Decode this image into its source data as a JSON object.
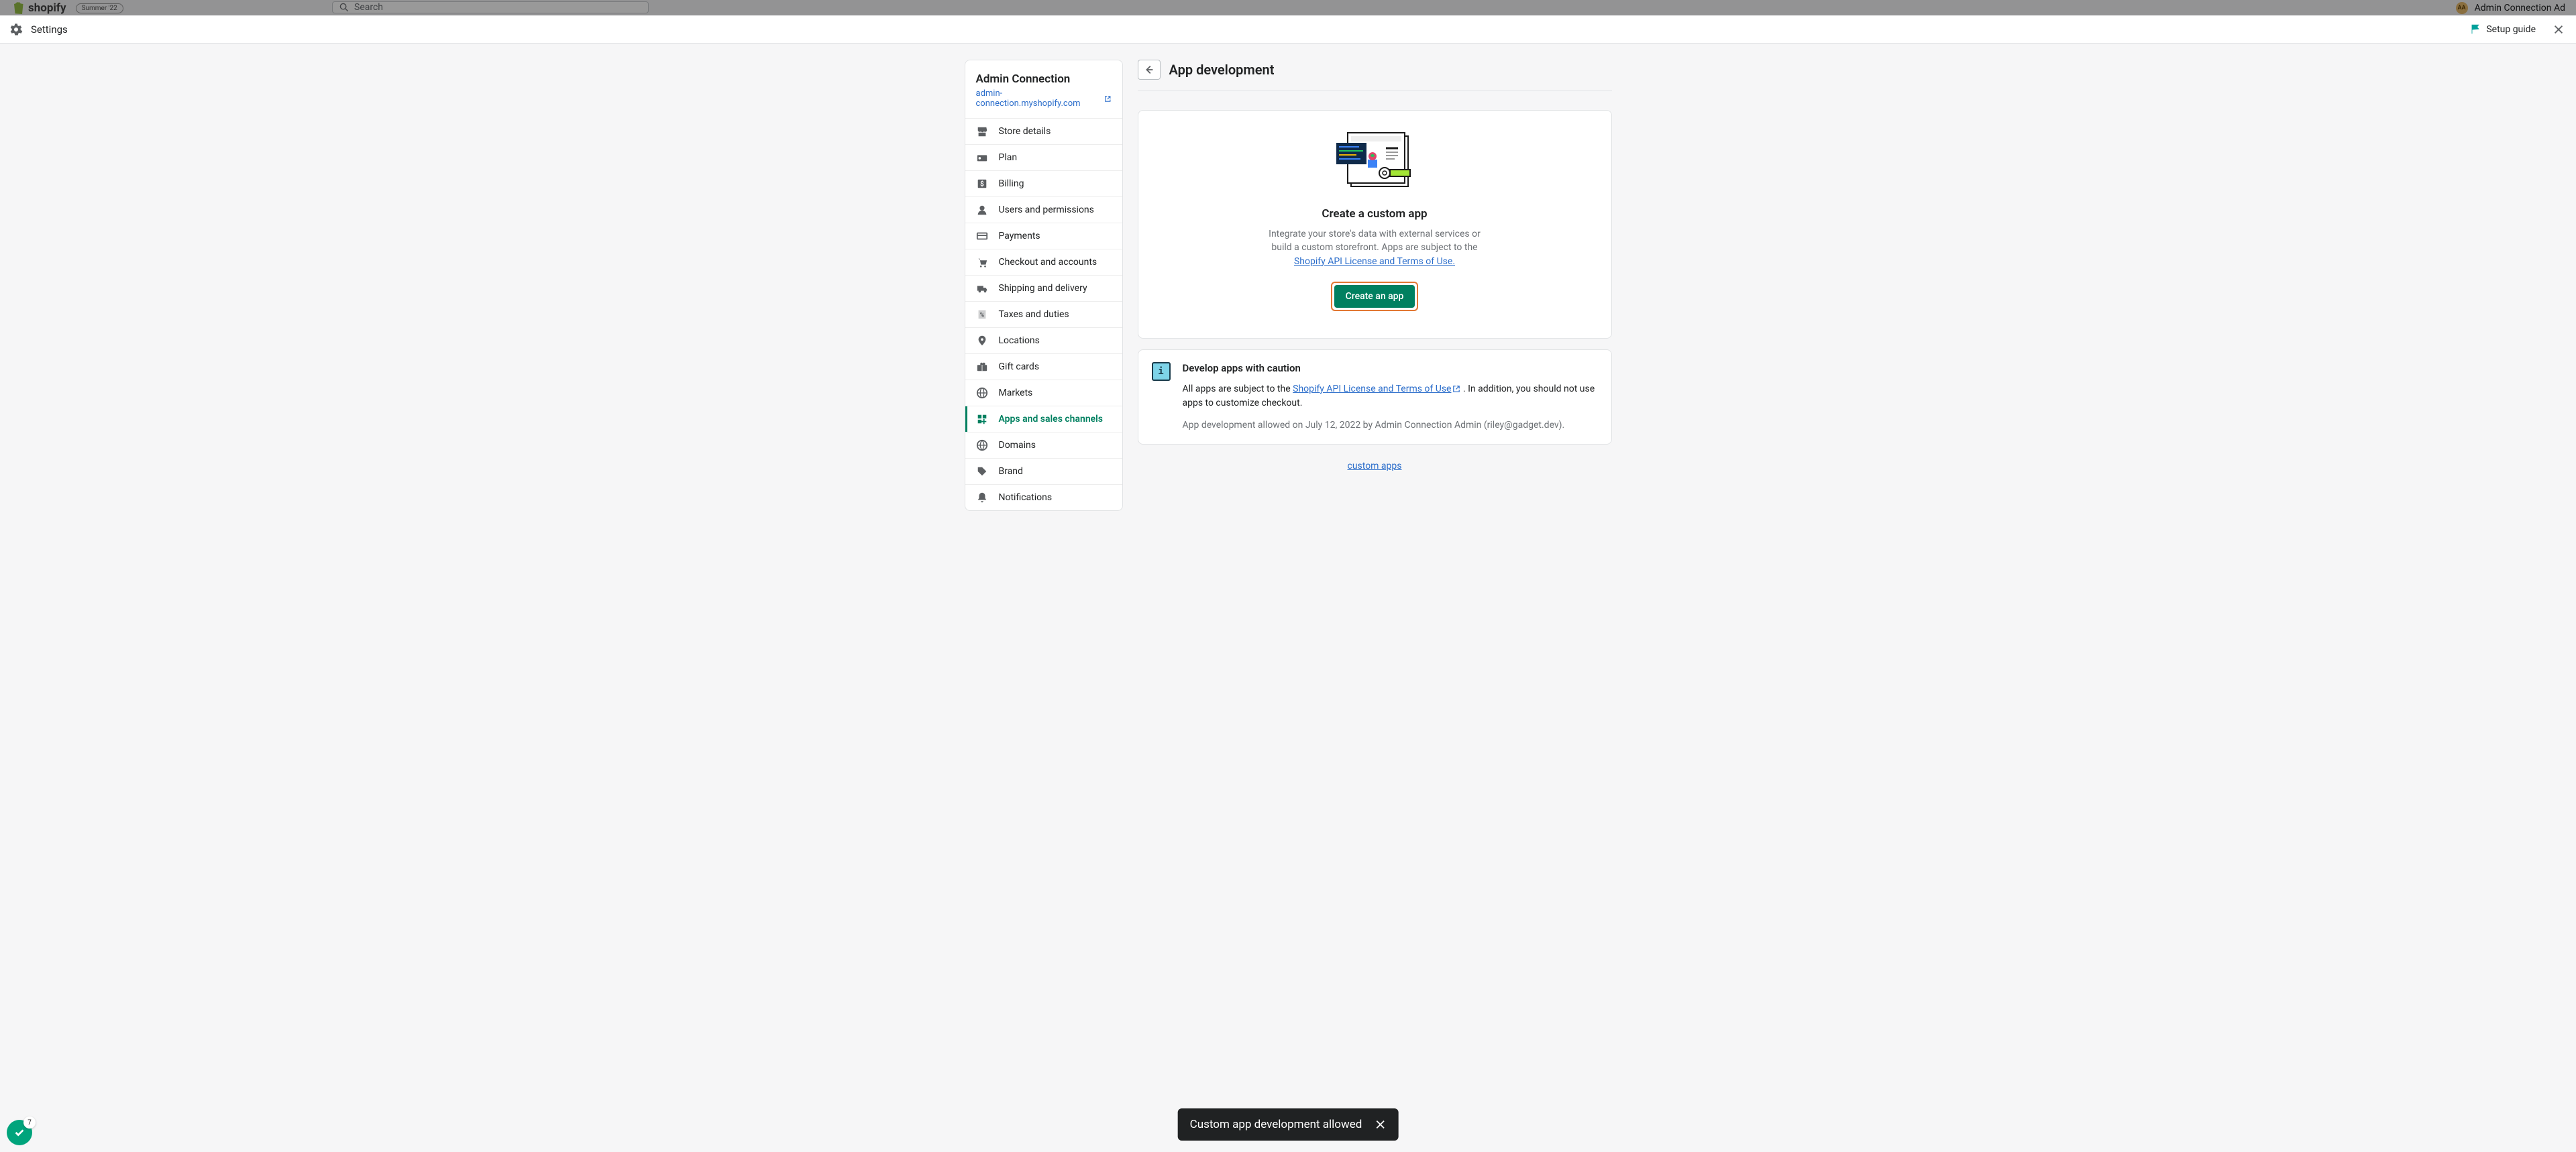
{
  "backdrop": {
    "logo_text": "shopify",
    "badge": "Summer '22",
    "search_placeholder": "Search",
    "user_name": "Admin Connection Ad",
    "user_initials": "AA"
  },
  "header": {
    "title": "Settings",
    "setup_guide": "Setup guide"
  },
  "sidebar": {
    "store_name": "Admin Connection",
    "store_url": "admin-connection.myshopify.com",
    "items": [
      {
        "label": "Store details",
        "icon": "store"
      },
      {
        "label": "Plan",
        "icon": "plan"
      },
      {
        "label": "Billing",
        "icon": "billing"
      },
      {
        "label": "Users and permissions",
        "icon": "users"
      },
      {
        "label": "Payments",
        "icon": "payments"
      },
      {
        "label": "Checkout and accounts",
        "icon": "checkout"
      },
      {
        "label": "Shipping and delivery",
        "icon": "shipping"
      },
      {
        "label": "Taxes and duties",
        "icon": "taxes"
      },
      {
        "label": "Locations",
        "icon": "locations"
      },
      {
        "label": "Gift cards",
        "icon": "giftcards"
      },
      {
        "label": "Markets",
        "icon": "markets"
      },
      {
        "label": "Apps and sales channels",
        "icon": "apps",
        "active": true
      },
      {
        "label": "Domains",
        "icon": "domains"
      },
      {
        "label": "Brand",
        "icon": "brand"
      },
      {
        "label": "Notifications",
        "icon": "notifications"
      }
    ]
  },
  "main": {
    "title": "App development",
    "create": {
      "heading": "Create a custom app",
      "desc_before": "Integrate your store's data with external services or build a custom storefront. Apps are subject to the ",
      "link_text": "Shopify API License and Terms of Use.",
      "button": "Create an app"
    },
    "caution": {
      "heading": "Develop apps with caution",
      "text_before": "All apps are subject to the ",
      "link_text": "Shopify API License and Terms of Use",
      "text_after": " . In addition, you should not use apps to customize checkout.",
      "meta": "App development allowed on July 12, 2022 by Admin Connection Admin (riley@gadget.dev)."
    },
    "footer": {
      "prefix_partial": "",
      "link_text": "custom apps"
    }
  },
  "toast": {
    "message": "Custom app development allowed"
  },
  "fab": {
    "badge": "7"
  }
}
